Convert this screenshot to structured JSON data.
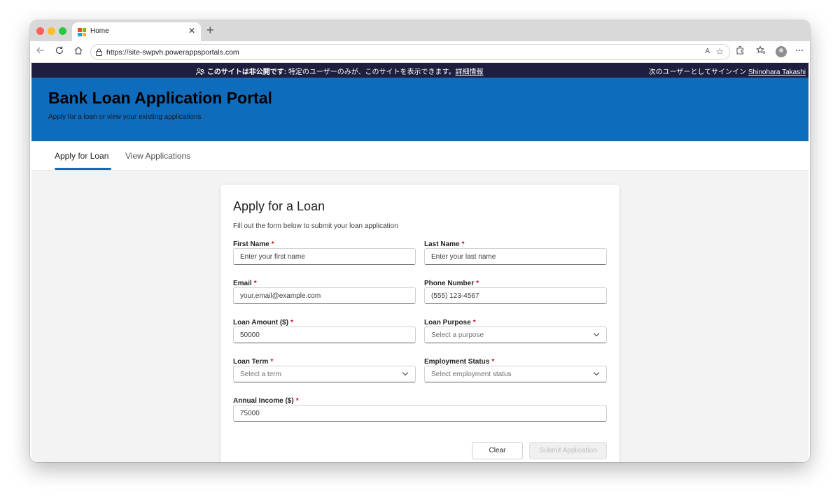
{
  "browser": {
    "tab_title": "Home",
    "close_glyph": "✕",
    "new_tab_glyph": "+",
    "url": "https://site-swpvh.powerappsportals.com",
    "reader_label": "A",
    "nav_icons": [
      "back-icon",
      "refresh-icon",
      "home-icon"
    ],
    "toolbar_icons": [
      "read-aloud-icon",
      "favorite-star-icon",
      "extensions-icon",
      "favorites-icon",
      "profile-avatar",
      "more-icon"
    ]
  },
  "banner": {
    "private_bold": "このサイトは非公開です:",
    "private_text": " 特定のユーザーのみが、このサイトを表示できます。",
    "more_info": "詳細情報",
    "signed_in_as": "次のユーザーとしてサインイン ",
    "user_name": "Shinohara Takashi"
  },
  "header": {
    "title": "Bank Loan Application Portal",
    "subtitle": "Apply for a loan or view your existing applications"
  },
  "nav": {
    "tabs": [
      {
        "label": "Apply for Loan",
        "active": true
      },
      {
        "label": "View Applications",
        "active": false
      }
    ]
  },
  "form": {
    "title": "Apply for a Loan",
    "description": "Fill out the form below to submit your loan application",
    "required_marker": "*",
    "fields": {
      "first_name": {
        "label": "First Name",
        "placeholder": "Enter your first name",
        "value": ""
      },
      "last_name": {
        "label": "Last Name",
        "placeholder": "Enter your last name",
        "value": ""
      },
      "email": {
        "label": "Email",
        "placeholder": "your.email@example.com",
        "value": ""
      },
      "phone": {
        "label": "Phone Number",
        "placeholder": "(555) 123-4567",
        "value": ""
      },
      "loan_amount": {
        "label": "Loan Amount ($)",
        "placeholder": "50000",
        "value": ""
      },
      "loan_purpose": {
        "label": "Loan Purpose",
        "placeholder": "Select a purpose"
      },
      "loan_term": {
        "label": "Loan Term",
        "placeholder": "Select a term"
      },
      "employment_status": {
        "label": "Employment Status",
        "placeholder": "Select employment status"
      },
      "annual_income": {
        "label": "Annual Income ($)",
        "placeholder": "75000",
        "value": ""
      }
    },
    "buttons": {
      "clear": "Clear",
      "submit": "Submit Application"
    }
  },
  "colors": {
    "header_blue": "#0f6cbd",
    "banner_dark": "#1e1e3f",
    "required_red": "#c50f1f",
    "disabled_text": "#bdbdbd"
  }
}
